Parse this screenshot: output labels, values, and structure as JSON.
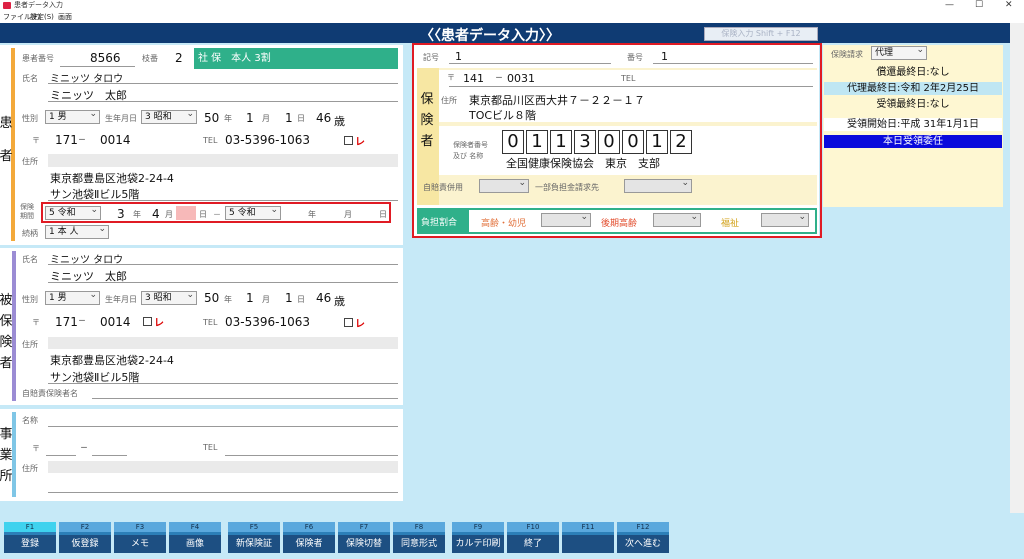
{
  "window": {
    "title": "患者データ入力",
    "minimize": "—",
    "maximize": "☐",
    "close": "✕"
  },
  "menu": [
    "ファイル(F)",
    "設定(S)",
    "画面"
  ],
  "header": {
    "title": "〈〈患者データ入力〉〉",
    "shortcut_button": "保険入力 Shift + F12"
  },
  "patient": {
    "side_label": [
      "患",
      "者"
    ],
    "number_label": "患者番号",
    "number": "8566",
    "branch_label": "枝番",
    "branch": "2",
    "insurance_badge": "社 保　本人 3割",
    "name_label": "氏名",
    "name_kana": "ミニッツ タロウ",
    "name": "ミニッツ　太郎",
    "sex_label": "性別",
    "sex": "1 男",
    "birth_label": "生年月日",
    "era": "3 昭和",
    "birth_year": "50",
    "year_unit": "年",
    "birth_month": "1",
    "month_unit": "月",
    "birth_day": "1",
    "day_unit": "日",
    "age": "46",
    "age_unit": "歳",
    "postal_mark": "〒",
    "postal1": "171",
    "dash": "－",
    "postal2": "0014",
    "tel_label": "TEL",
    "tel": "03-5396-1063",
    "check_mark": "レ",
    "address_label": "住所",
    "address1": "東京都豊島区池袋2-24-4",
    "address2": "サン池袋Ⅱビル5階",
    "period_label": [
      "保険",
      "期間"
    ],
    "period_start_era": "5 令和",
    "period_start_year": "3",
    "period_start_year_unit": "年",
    "period_start_month": "4",
    "period_start_month_unit": "月",
    "period_start_day_unit": "日",
    "period_sep": "－",
    "period_end_era": "5 令和",
    "period_end_year_unit": "年",
    "period_end_month_unit": "月",
    "period_end_day_unit": "日",
    "relation_label": "続柄",
    "relation": "1 本 人"
  },
  "insured": {
    "side_label": [
      "被",
      "保",
      "険",
      "者"
    ],
    "name_label": "氏名",
    "name_kana": "ミニッツ タロウ",
    "name": "ミニッツ　太郎",
    "sex_label": "性別",
    "sex": "1 男",
    "birth_label": "生年月日",
    "era": "3 昭和",
    "birth_year": "50",
    "year_unit": "年",
    "birth_month": "1",
    "month_unit": "月",
    "birth_day": "1",
    "day_unit": "日",
    "age": "46",
    "age_unit": "歳",
    "postal_mark": "〒",
    "postal1": "171",
    "dash": "－",
    "postal2": "0014",
    "postal_check": "レ",
    "tel_label": "TEL",
    "tel": "03-5396-1063",
    "check_mark": "レ",
    "address_label": "住所",
    "address1": "東京都豊島区池袋2-24-4",
    "address2": "サン池袋Ⅱビル5階",
    "auto_insurer_label": "自賠責保険者名"
  },
  "office": {
    "side_label": [
      "事",
      "業",
      "所"
    ],
    "name_label": "名称",
    "postal_mark": "〒",
    "dash": "－",
    "tel_label": "TEL",
    "address_label": "住所"
  },
  "insurer": {
    "side_label": [
      "保",
      "険",
      "者"
    ],
    "kigo_label": "記号",
    "kigo": "1",
    "bango_label": "番号",
    "bango": "1",
    "postal_mark": "〒",
    "postal1": "141",
    "dash": "－",
    "postal2": "0031",
    "tel_label": "TEL",
    "address_label": "住所",
    "address1": "東京都品川区西大井７－２２－１７",
    "address2": "TOCビル８階",
    "number_label": [
      "保険者番号",
      "及び 名称"
    ],
    "number_digits": [
      "0",
      "1",
      "1",
      "3",
      "0",
      "0",
      "1",
      "2"
    ],
    "name": "全国健康保険協会　東京　支部",
    "auto_label": "自賠責併用",
    "partial_label": "一部負担金請求先",
    "burden_label": "負担割合",
    "elderly_child_label": "高齢・幼児",
    "late_elderly_label": "後期高齢",
    "welfare_label": "福祉"
  },
  "right": {
    "claim_label": "保険請求",
    "claim_value": "代理",
    "repay_last": "償還最終日:なし",
    "agent_last": "代理最終日:令和 2年2月25日",
    "receipt_last": "受領最終日:なし",
    "receipt_start": "受領開始日:平成 31年1月1日",
    "today_delegation": "本日受領委任"
  },
  "fkeys": [
    {
      "key": "F1",
      "label": "登録"
    },
    {
      "key": "F2",
      "label": "仮登録"
    },
    {
      "key": "F3",
      "label": "メモ"
    },
    {
      "key": "F4",
      "label": "画像"
    },
    {
      "key": "F5",
      "label": "新保険証"
    },
    {
      "key": "F6",
      "label": "保険者"
    },
    {
      "key": "F7",
      "label": "保険切替"
    },
    {
      "key": "F8",
      "label": "同意形式"
    },
    {
      "key": "F9",
      "label": "カルテ印刷"
    },
    {
      "key": "F10",
      "label": "終了"
    },
    {
      "key": "F11",
      "label": ""
    },
    {
      "key": "F12",
      "label": "次へ進む"
    }
  ],
  "colors": {
    "header": "#0f3b73",
    "badge": "#2fb08a",
    "highlight": "#e01b24",
    "delegation": "#0a0adc",
    "agent": "#bfe6f3",
    "fkey": "#1d4f82"
  }
}
